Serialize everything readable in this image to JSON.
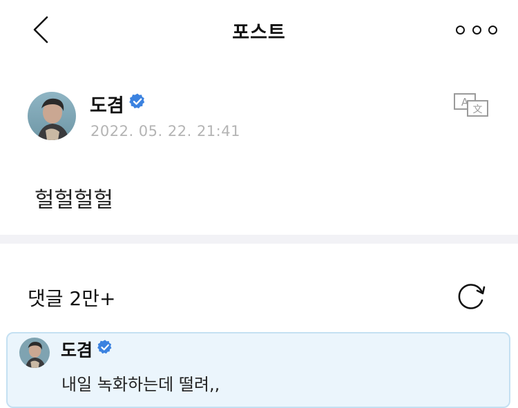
{
  "header": {
    "title": "포스트",
    "back_icon": "chevron-left-icon",
    "more_icon": "more-dots-icon"
  },
  "post": {
    "author": "도겸",
    "verified": true,
    "timestamp": "2022. 05. 22. 21:41",
    "body": "헐헐헐헐",
    "translate_icon": "translate-icon"
  },
  "comments": {
    "title": "댓글 2만+",
    "refresh_icon": "refresh-icon",
    "highlighted": {
      "author": "도겸",
      "verified": true,
      "text": "내일 녹화하는데 떨려,,"
    }
  },
  "colors": {
    "verified_blue": "#3b82e0",
    "timestamp_gray": "#b4b4b4",
    "comment_bg": "#ebf5fc",
    "comment_border": "#c4e0f2",
    "divider": "#f2f2f6"
  }
}
